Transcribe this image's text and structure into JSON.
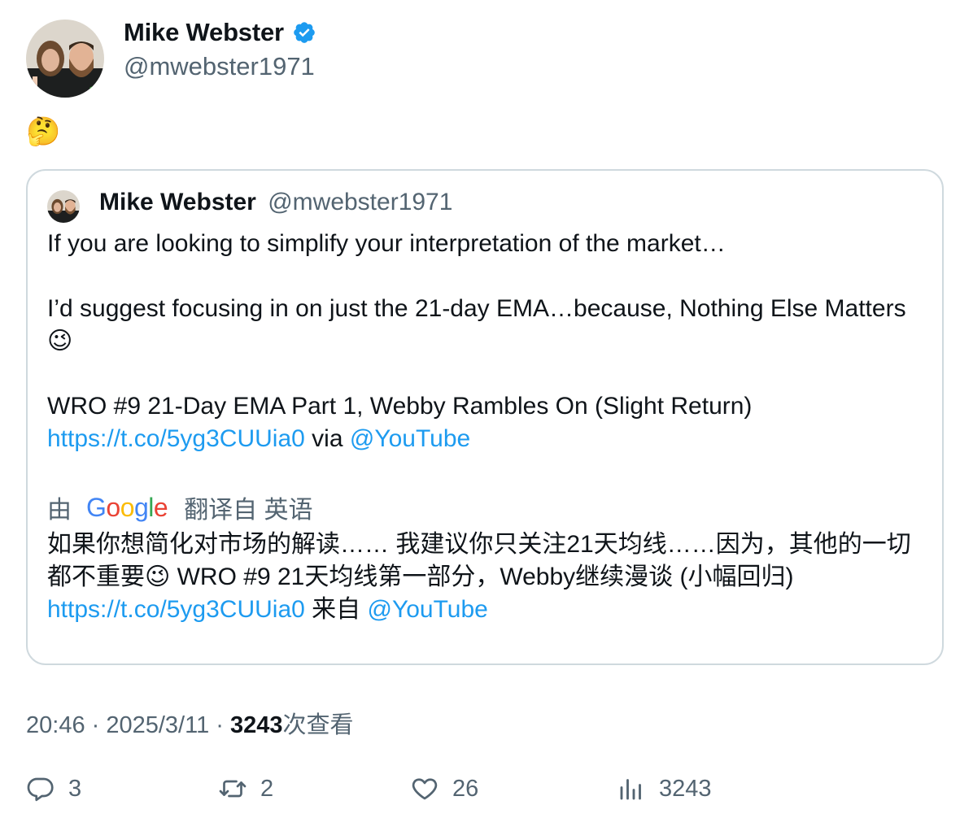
{
  "author": {
    "name": "Mike Webster",
    "handle": "@mwebster1971"
  },
  "tweet": {
    "text": "🤔"
  },
  "quoted": {
    "name": "Mike Webster",
    "handle": "@mwebster1971",
    "line1": "If you are looking to simplify your interpretation of the market…",
    "line2": "I’d suggest focusing in on just the 21-day EMA…because, Nothing Else Matters😉",
    "line3": "WRO #9 21-Day EMA Part 1, Webby Rambles On (Slight Return)",
    "link": "https://t.co/5yg3CUUia0",
    "via": " via ",
    "mention": "@YouTube"
  },
  "translation": {
    "by": "由",
    "google": "Google",
    "from": "翻译自 英语",
    "text": "如果你想简化对市场的解读…… 我建议你只关注21天均线……因为，其他的一切都不重要😉 WRO #9 21天均线第一部分，Webby继续漫谈 (小幅回归)",
    "link": "https://t.co/5yg3CUUia0",
    "from_word": " 来自 ",
    "mention": "@YouTube"
  },
  "meta": {
    "time": "20:46",
    "sep1": " · ",
    "date": "2025/3/11",
    "sep2": " · ",
    "views_count": "3243",
    "views_label": "次查看"
  },
  "actions": {
    "reply_count": "3",
    "retweet_count": "2",
    "like_count": "26",
    "view_count": "3243"
  },
  "colors": {
    "link": "#1d9bf0",
    "secondary_text": "#536471",
    "verified": "#1d9bf0"
  }
}
